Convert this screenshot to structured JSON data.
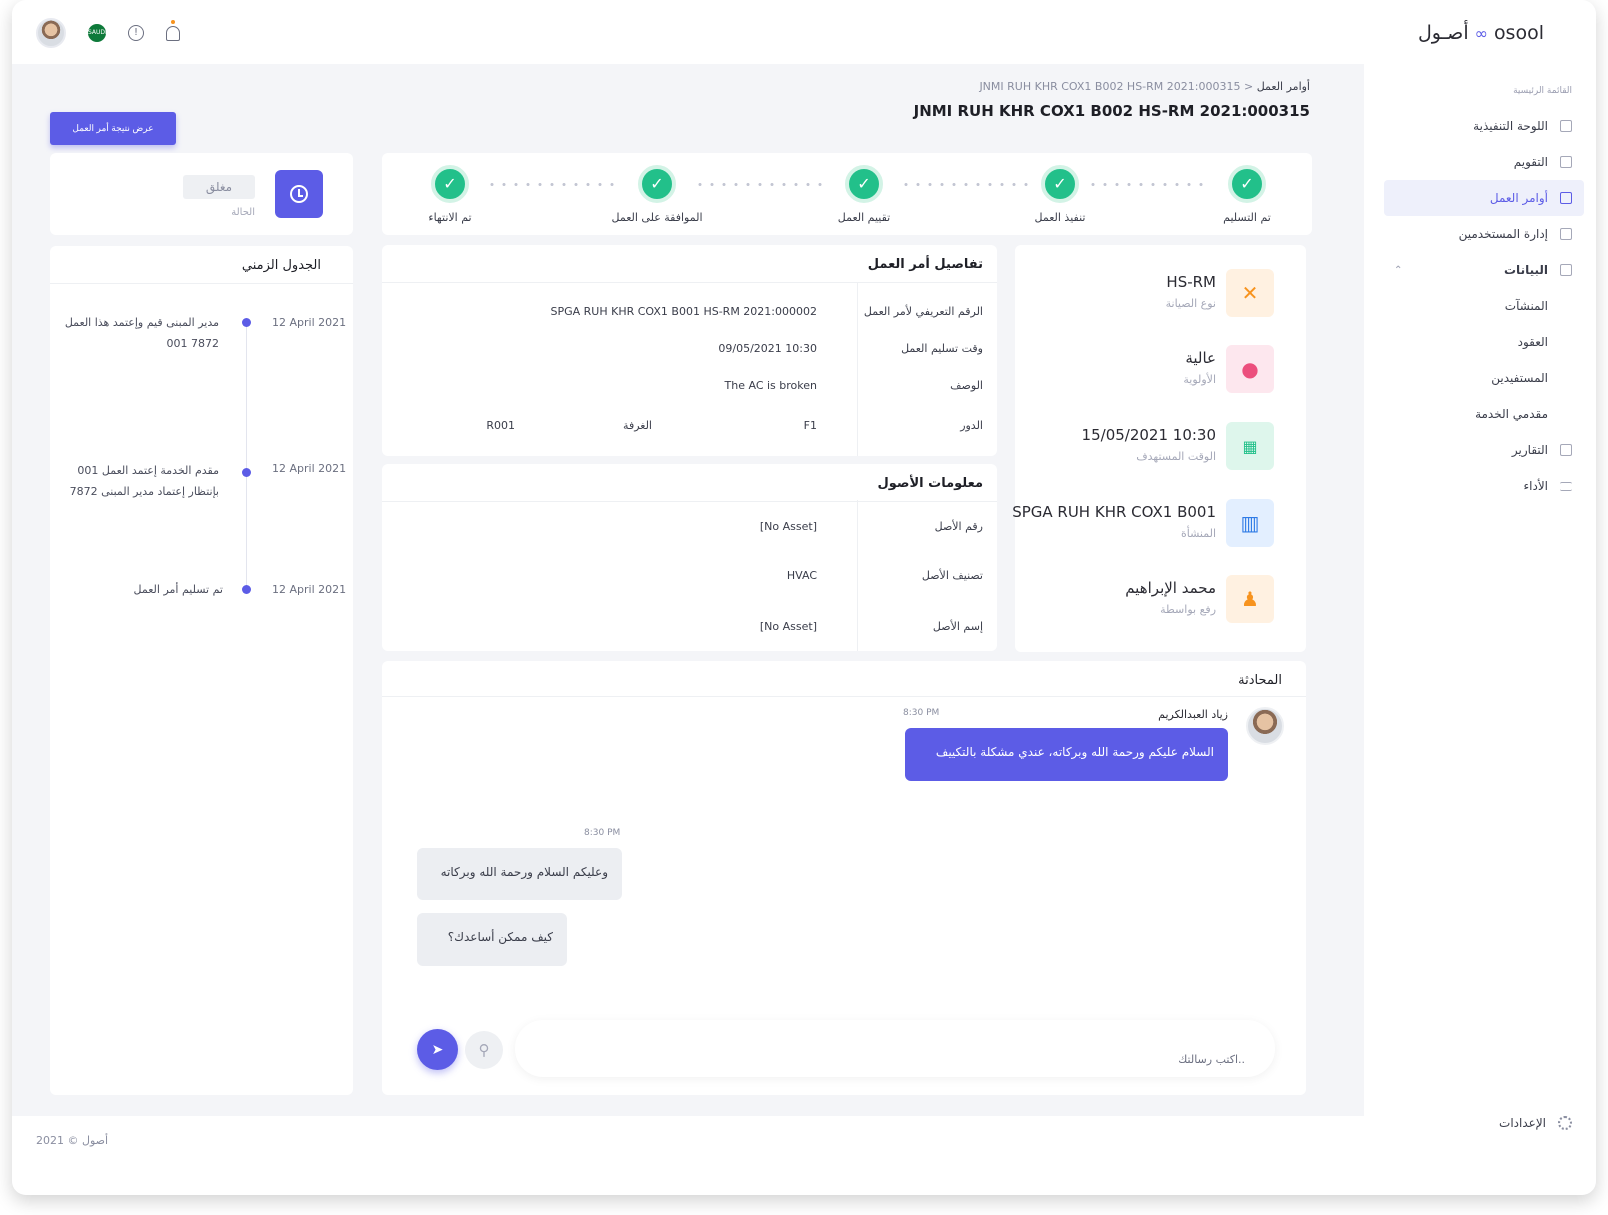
{
  "app": {
    "logo_ar": "أصـول",
    "logo_en": "osool",
    "logo_symbol": "∞",
    "accent": "#5c5ce6",
    "success": "#22c08a"
  },
  "header": {
    "lang_flag": "SAUDI"
  },
  "sidebar": {
    "menu_title": "القائمة الرئيسية",
    "items": [
      {
        "label": "اللوحة التنفيذية",
        "icon": "home-icon"
      },
      {
        "label": "التقويم",
        "icon": "calendar-icon"
      },
      {
        "label": "أوامر العمل",
        "icon": "workorder-icon",
        "active": true
      },
      {
        "label": "إدارة المستخدمين",
        "icon": "user-icon"
      },
      {
        "label": "البيانات",
        "icon": "data-icon"
      },
      {
        "label": "المنشآت"
      },
      {
        "label": "العقود"
      },
      {
        "label": "المستفيدين"
      },
      {
        "label": "مقدمي الخدمة"
      },
      {
        "label": "التقارير",
        "icon": "report-icon"
      },
      {
        "label": "الأداء",
        "icon": "performance-icon"
      }
    ],
    "settings": "الإعدادات"
  },
  "breadcrumb": {
    "parent": "أوامر العمل",
    "current": "JNMI RUH KHR COX1 B002 HS-RM 2021:000315",
    "sep": ">"
  },
  "page_title": "JNMI RUH KHR COX1 B002 HS-RM 2021:000315",
  "actions": {
    "view_result": "عرض نتيجة أمر العمل"
  },
  "status": {
    "value": "مغلق",
    "label": "الحالة"
  },
  "stepper": [
    "تم التسليم",
    "تنفيذ العمل",
    "تقييم العمل",
    "الموافقة على العمل",
    "تم الانتهاء"
  ],
  "info": [
    {
      "value": "HS-RM",
      "label": "نوع الصيانة",
      "icon": "tools-icon",
      "color": "#f7931e",
      "bg": "#fff1e1"
    },
    {
      "value": "عالية",
      "label": "الأولوية",
      "icon": "priority-icon",
      "color": "#ec4f7d",
      "bg": "#fde7ee"
    },
    {
      "value": "15/05/2021 10:30",
      "label": "الوقت المستهدف",
      "icon": "calendar-icon",
      "color": "#22c08a",
      "bg": "#def6ec"
    },
    {
      "value": "SPGA RUH KHR COX1 B001",
      "label": "المنشأة",
      "icon": "building-icon",
      "color": "#2f7be6",
      "bg": "#e3efff"
    },
    {
      "value": "محمد الإبراهيم",
      "label": "رفع بواسطة",
      "icon": "person-icon",
      "color": "#f7931e",
      "bg": "#fff1e1"
    }
  ],
  "details": {
    "title": "تفاصيل أمر العمل",
    "rows": [
      {
        "label": "الرقم التعريفي لأمر العمل",
        "value": "SPGA RUH KHR COX1 B001 HS-RM 2021:000002"
      },
      {
        "label": "وقت تسليم العمل",
        "value": "09/05/2021 10:30"
      },
      {
        "label": "الوصف",
        "value": "The AC is broken"
      }
    ],
    "floor": {
      "label": "الدور",
      "value": "F1",
      "room_label": "الغرفة",
      "room_value": "R001"
    }
  },
  "assets": {
    "title": "معلومات الأصول",
    "rows": [
      {
        "label": "رقم الأصل",
        "value": "[No Asset]"
      },
      {
        "label": "تصنيف الأصل",
        "value": "HVAC"
      },
      {
        "label": "إسم الأصل",
        "value": "[No Asset]"
      }
    ]
  },
  "timeline": {
    "title": "الجدول الزمني",
    "items": [
      {
        "date": "12 April 2021",
        "text": "مدير المبنى قيم وإعتمد هذا العمل 7872 001"
      },
      {
        "date": "12 April 2021",
        "text": "مقدم الخدمة إعتمد العمل 001 بإنتظار إعتماد مدير المبنى 7872"
      },
      {
        "date": "12 April 2021",
        "text": "تم تسليم أمر العمل"
      }
    ]
  },
  "chat": {
    "title": "المحادثة",
    "sender": "زياد العبدالكريم",
    "sent_time": "8:30 PM",
    "sent_message": "السلام عليكم ورحمة الله وبركاته، عندي مشكلة بالتكييف",
    "reply_time": "8:30 PM",
    "replies": [
      "وعليكم السلام ورحمة الله وبركاته",
      "كيف ممكن أساعدك؟"
    ],
    "placeholder": "اكتب رسالتك.."
  },
  "footer": {
    "copyright": "أصول © 2021"
  }
}
